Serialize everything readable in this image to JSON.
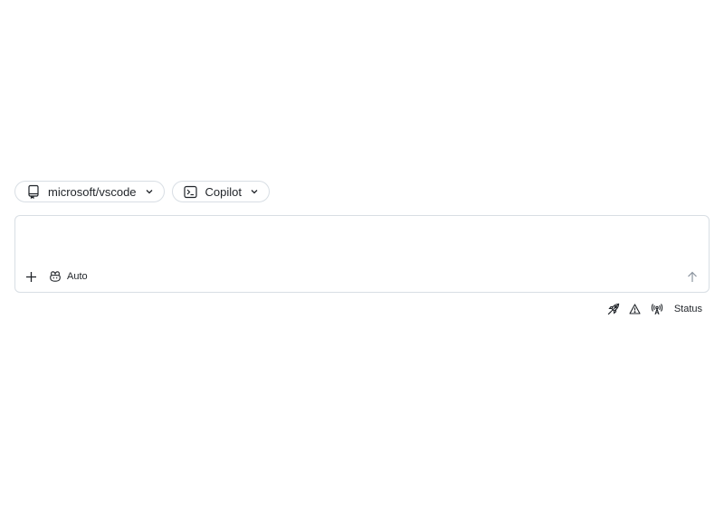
{
  "selectors": {
    "repo": {
      "label": "microsoft/vscode",
      "icon": "repo-icon"
    },
    "agent": {
      "label": "Copilot",
      "icon": "terminal-icon"
    }
  },
  "composer": {
    "value": "",
    "placeholder": "",
    "model_label": "Auto",
    "add_icon": "plus-icon",
    "model_icon": "copilot-icon",
    "send_icon": "arrow-up-icon"
  },
  "status_bar": {
    "label": "Status",
    "icons": [
      "rocket-icon",
      "alert-icon",
      "broadcast-icon"
    ]
  },
  "colors": {
    "border": "#d8dee4",
    "text": "#1f2328",
    "muted": "#8c959f"
  }
}
